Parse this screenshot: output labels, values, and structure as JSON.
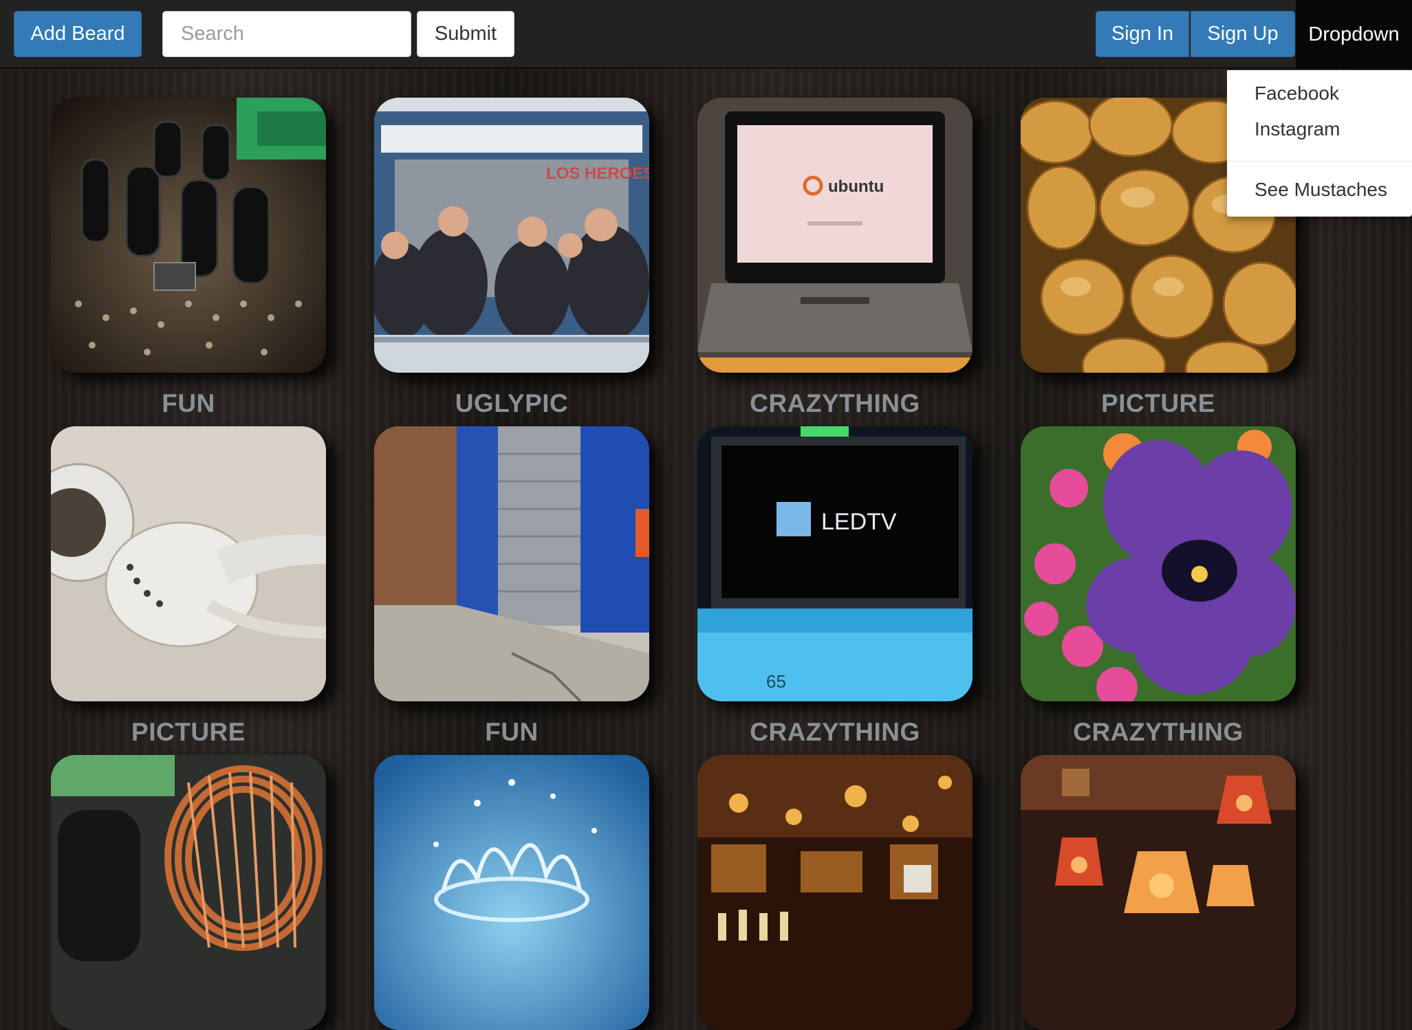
{
  "navbar": {
    "add_label": "Add Beard",
    "search_placeholder": "Search",
    "submit_label": "Submit",
    "signin_label": "Sign In",
    "signup_label": "Sign Up",
    "dropdown_label": "Dropdown"
  },
  "dropdown": {
    "items": [
      "Facebook",
      "Instagram"
    ],
    "footer_item": "See Mustaches"
  },
  "colors": {
    "primary": "#337ab7",
    "navbar": "#222222",
    "caption": "#8a9196"
  },
  "images": {
    "ubuntu_logo_text": "ubuntu",
    "led_tv_text": "LEDTV",
    "station_sign": "LOS HEROES",
    "tv_model": "65"
  },
  "tiles": [
    {
      "caption": "FUN",
      "icon": "circuit-board-image"
    },
    {
      "caption": "UGLYPIC",
      "icon": "train-passengers-image"
    },
    {
      "caption": "CRAZYTHING",
      "icon": "ubuntu-laptop-image"
    },
    {
      "caption": "PICTURE",
      "icon": "peanuts-image"
    },
    {
      "caption": "PICTURE",
      "icon": "earbuds-image"
    },
    {
      "caption": "FUN",
      "icon": "street-wall-image"
    },
    {
      "caption": "CRAZYTHING",
      "icon": "led-tv-image"
    },
    {
      "caption": "CRAZYTHING",
      "icon": "pansy-flower-image"
    },
    {
      "caption": "",
      "icon": "copper-coil-image"
    },
    {
      "caption": "",
      "icon": "water-splash-image"
    },
    {
      "caption": "",
      "icon": "bar-interior-image"
    },
    {
      "caption": "",
      "icon": "lanterns-image"
    }
  ]
}
